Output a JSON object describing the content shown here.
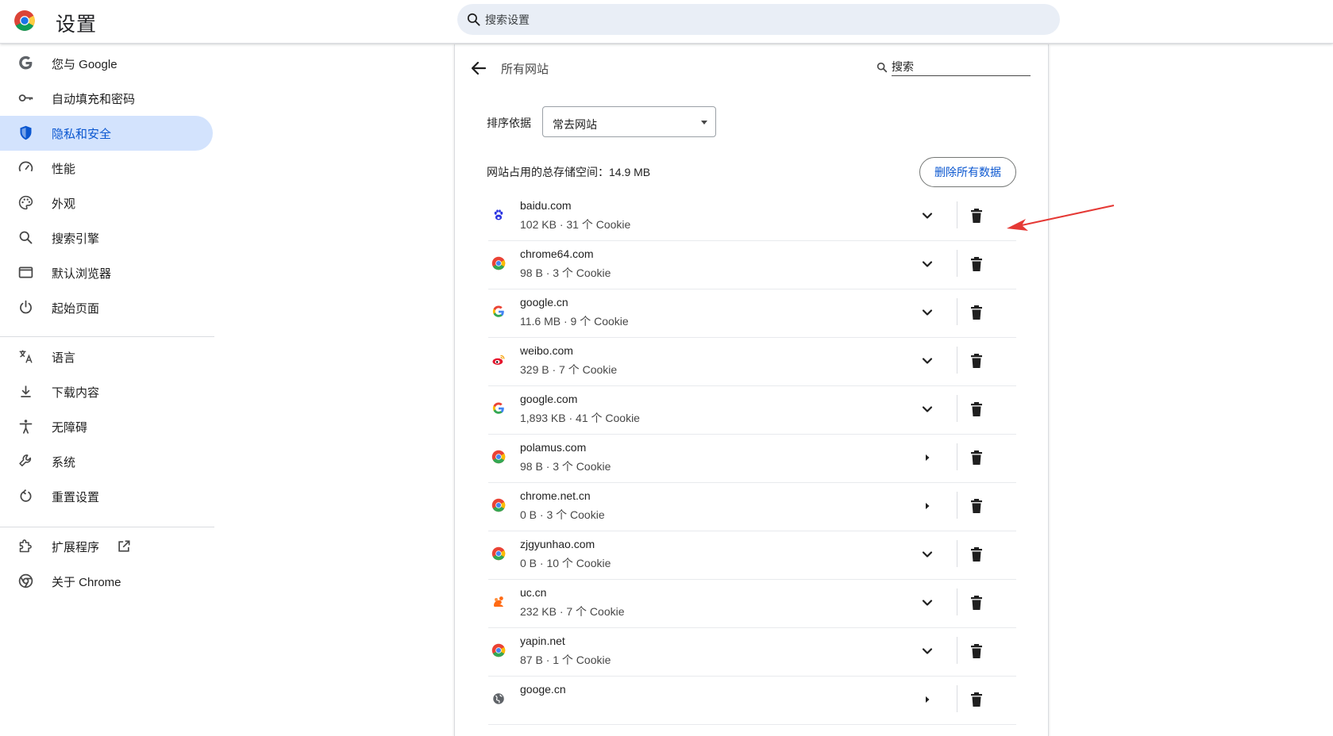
{
  "header": {
    "title": "设置",
    "search_placeholder": "搜索设置",
    "logo_icon": "chrome-logo-icon"
  },
  "sidebar": {
    "items": [
      {
        "label": "您与 Google",
        "icon": "google-g-icon",
        "active": false
      },
      {
        "label": "自动填充和密码",
        "icon": "key-icon",
        "active": false
      },
      {
        "label": "隐私和安全",
        "icon": "shield-icon",
        "active": true
      },
      {
        "label": "性能",
        "icon": "speedometer-icon",
        "active": false
      },
      {
        "label": "外观",
        "icon": "palette-icon",
        "active": false
      },
      {
        "label": "搜索引擎",
        "icon": "search-icon",
        "active": false
      },
      {
        "label": "默认浏览器",
        "icon": "browser-window-icon",
        "active": false
      },
      {
        "label": "起始页面",
        "icon": "power-icon",
        "active": false
      },
      {
        "label": "语言",
        "icon": "translate-icon",
        "active": false
      },
      {
        "label": "下载内容",
        "icon": "download-icon",
        "active": false
      },
      {
        "label": "无障碍",
        "icon": "accessibility-icon",
        "active": false
      },
      {
        "label": "系统",
        "icon": "wrench-icon",
        "active": false
      },
      {
        "label": "重置设置",
        "icon": "reset-icon",
        "active": false
      },
      {
        "label": "扩展程序",
        "icon": "puzzle-icon",
        "active": false
      },
      {
        "label": "关于 Chrome",
        "icon": "chrome-icon",
        "active": false
      }
    ]
  },
  "main": {
    "title": "所有网站",
    "search_placeholder": "搜索",
    "sort_label": "排序依据",
    "sort_value": "常去网站",
    "storage_text": "网站占用的总存储空间：14.9 MB",
    "delete_all_label": "删除所有数据",
    "sites": [
      {
        "name": "baidu.com",
        "meta": "102 KB · 31 个 Cookie",
        "favicon": "baidu-paw-icon",
        "expand": "chevron-down"
      },
      {
        "name": "chrome64.com",
        "meta": "98 B · 3 个 Cookie",
        "favicon": "chrome-favicon",
        "expand": "chevron-down"
      },
      {
        "name": "google.cn",
        "meta": "11.6 MB · 9 个 Cookie",
        "favicon": "google-favicon-small",
        "expand": "chevron-down"
      },
      {
        "name": "weibo.com",
        "meta": "329 B · 7 个 Cookie",
        "favicon": "weibo-favicon",
        "expand": "chevron-down"
      },
      {
        "name": "google.com",
        "meta": "1,893 KB · 41 个 Cookie",
        "favicon": "google-favicon",
        "expand": "chevron-down"
      },
      {
        "name": "polamus.com",
        "meta": "98 B · 3 个 Cookie",
        "favicon": "chrome-favicon",
        "expand": "triangle-right"
      },
      {
        "name": "chrome.net.cn",
        "meta": "0 B · 3 个 Cookie",
        "favicon": "chrome-favicon",
        "expand": "triangle-right"
      },
      {
        "name": "zjgyunhao.com",
        "meta": "0 B · 10 个 Cookie",
        "favicon": "chrome-favicon",
        "expand": "chevron-down"
      },
      {
        "name": "uc.cn",
        "meta": "232 KB · 7 个 Cookie",
        "favicon": "uc-squirrel-favicon",
        "expand": "chevron-down"
      },
      {
        "name": "yapin.net",
        "meta": "87 B · 1 个 Cookie",
        "favicon": "chrome-favicon",
        "expand": "chevron-down"
      },
      {
        "name": "googe.cn",
        "meta": "",
        "favicon": "globe-favicon",
        "expand": "triangle-right"
      }
    ]
  },
  "colors": {
    "accent": "#0b57d0",
    "active_bg": "#d3e3fd",
    "annotation_arrow": "#e53935"
  }
}
